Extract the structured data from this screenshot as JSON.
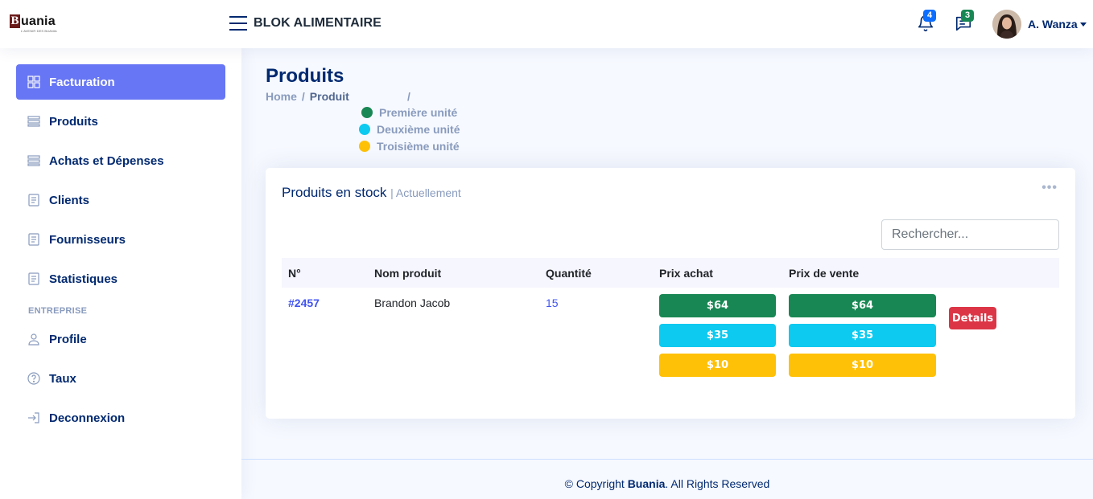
{
  "brand": {
    "letter": "B",
    "name": "uania",
    "tagline": "L'AVENIR DES BUANIA"
  },
  "header": {
    "app_title": "BLOK ALIMENTAIRE",
    "notifications_count": "4",
    "messages_count": "3",
    "user_name": "A. Wanza"
  },
  "sidebar": {
    "items": [
      {
        "label": "Facturation",
        "icon": "grid-icon"
      },
      {
        "label": "Produits",
        "icon": "list-icon"
      },
      {
        "label": "Achats et Dépenses",
        "icon": "list-icon"
      },
      {
        "label": "Clients",
        "icon": "document-icon"
      },
      {
        "label": "Fournisseurs",
        "icon": "document-icon"
      },
      {
        "label": "Statistiques",
        "icon": "document-icon"
      }
    ],
    "heading": "ENTREPRISE",
    "items2": [
      {
        "label": "Profile",
        "icon": "person-icon"
      },
      {
        "label": "Taux",
        "icon": "question-icon"
      },
      {
        "label": "Deconnexion",
        "icon": "logout-icon"
      }
    ]
  },
  "page": {
    "title": "Produits",
    "breadcrumb": {
      "home": "Home",
      "sep": "/",
      "current": "Produit",
      "sep2": "/"
    },
    "legend": [
      {
        "label": "Première unité",
        "color": "#198754"
      },
      {
        "label": "Deuxième unité",
        "color": "#0dcaf0"
      },
      {
        "label": "Troisième unité",
        "color": "#ffc107"
      }
    ]
  },
  "card": {
    "title": "Produits en stock",
    "subtitle": "| Actuellement",
    "menu": "•••",
    "search_placeholder": "Rechercher...",
    "columns": [
      "N°",
      "Nom produit",
      "Quantité",
      "Prix achat",
      "Prix de vente"
    ],
    "row": {
      "id": "#2457",
      "name": "Brandon Jacob",
      "quantity": "15",
      "prix_achat": [
        "$64",
        "$35",
        "$10"
      ],
      "prix_vente": [
        "$64",
        "$35",
        "$10"
      ],
      "action": "Details"
    }
  },
  "footer": {
    "prefix": "© Copyright ",
    "brand": "Buania",
    "suffix": ". All Rights Reserved"
  }
}
